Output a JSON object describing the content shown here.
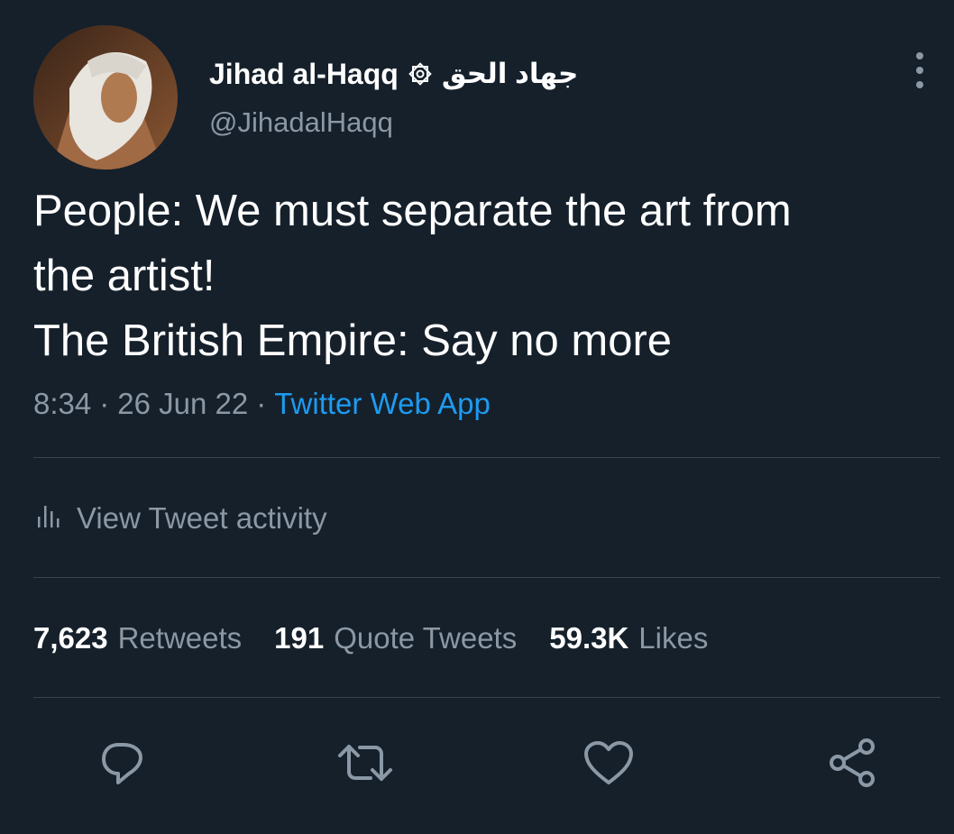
{
  "author": {
    "display_name": "Jihad al-Haqq",
    "arabic_name": "جهاد الحق",
    "handle": "@JihadalHaqq"
  },
  "tweet": {
    "lines": [
      "People: We must separate the art from",
      "the artist!",
      "The British Empire: Say no more"
    ],
    "time": "8:34",
    "separator": "·",
    "date": "26 Jun 22",
    "source": "Twitter Web App"
  },
  "activity": {
    "label": "View Tweet activity",
    "icon": "bar-chart-icon"
  },
  "stats": [
    {
      "count": "7,623",
      "label": "Retweets"
    },
    {
      "count": "191",
      "label": "Quote Tweets"
    },
    {
      "count": "59.3K",
      "label": "Likes"
    }
  ],
  "actions": [
    "reply-icon",
    "retweet-icon",
    "like-icon",
    "share-icon"
  ],
  "colors": {
    "background": "#15202b",
    "primary_text": "#ffffff",
    "secondary_text": "#8b98a5",
    "accent": "#1d9bf0",
    "divider": "#38444d"
  }
}
